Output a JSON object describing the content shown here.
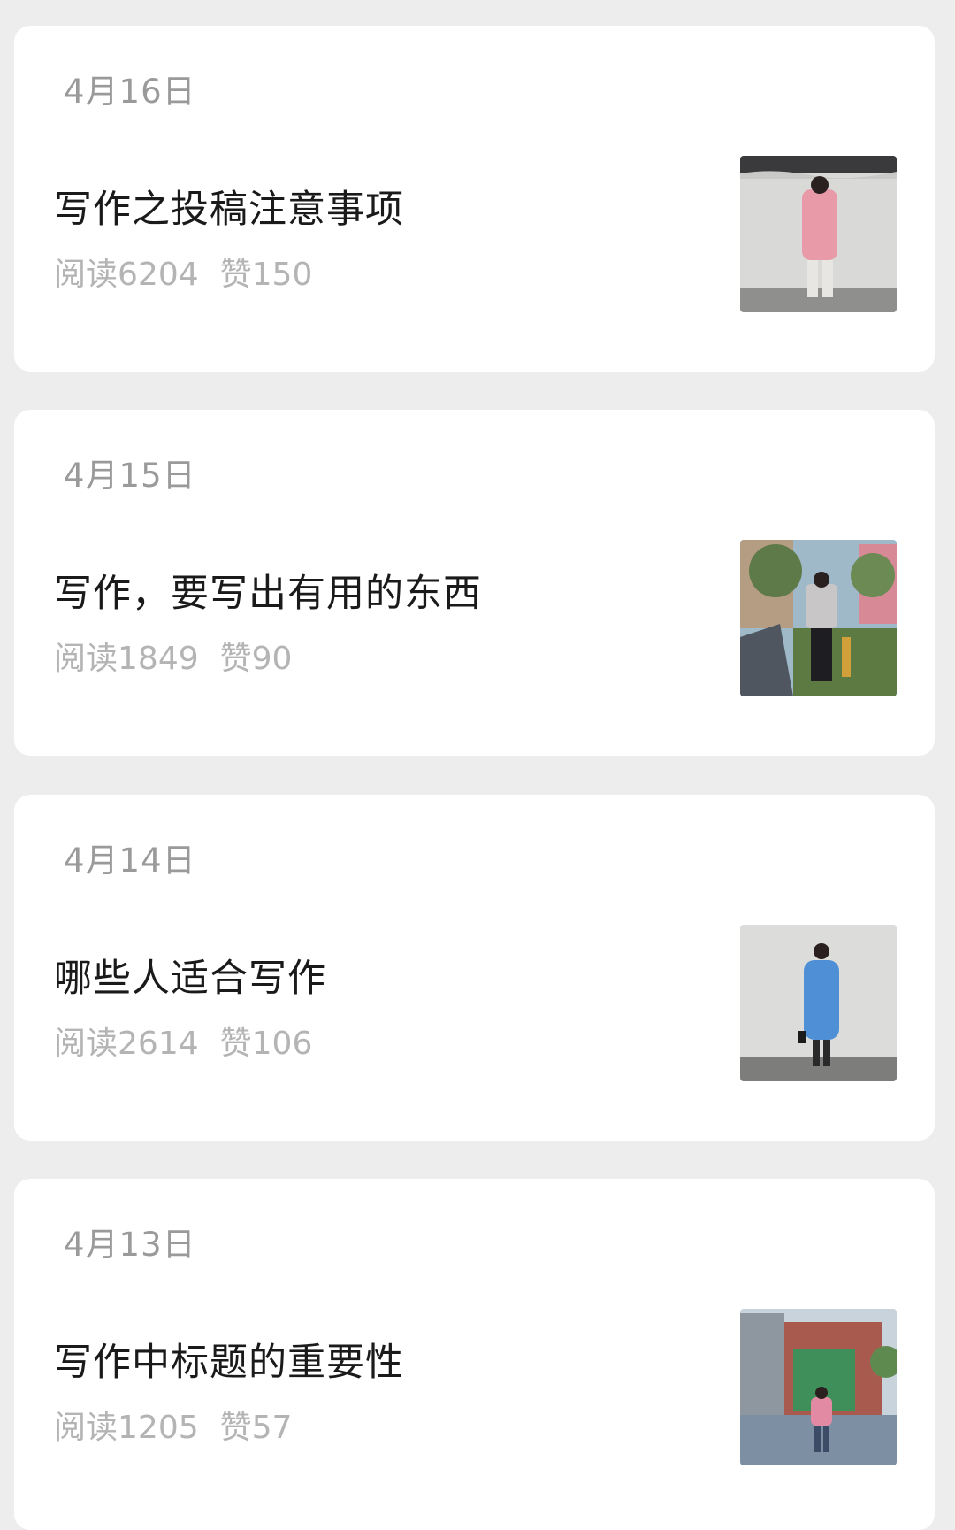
{
  "articles": [
    {
      "date": "4月16日",
      "title": "写作之投稿注意事项",
      "reads_label": "阅读",
      "reads": "6204",
      "likes_label": "赞",
      "likes": "150"
    },
    {
      "date": "4月15日",
      "title": "写作，要写出有用的东西",
      "reads_label": "阅读",
      "reads": "1849",
      "likes_label": "赞",
      "likes": "90"
    },
    {
      "date": "4月14日",
      "title": "哪些人适合写作",
      "reads_label": "阅读",
      "reads": "2614",
      "likes_label": "赞",
      "likes": "106"
    },
    {
      "date": "4月13日",
      "title": "写作中标题的重要性",
      "reads_label": "阅读",
      "reads": "1205",
      "likes_label": "赞",
      "likes": "57"
    }
  ]
}
